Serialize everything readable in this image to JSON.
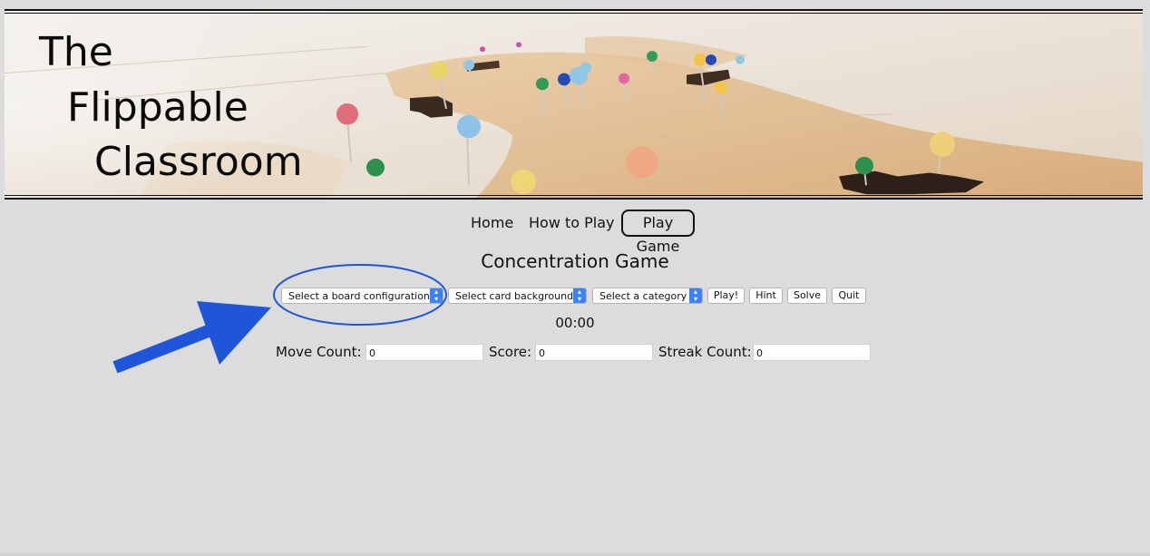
{
  "banner": {
    "title_lines": [
      "The",
      "Flippable",
      "Classroom"
    ]
  },
  "nav": {
    "items": [
      {
        "label": "Home"
      },
      {
        "label": "How to Play"
      },
      {
        "label": "Play Game",
        "active": true
      }
    ]
  },
  "game": {
    "title": "Concentration Game",
    "controls": {
      "board_select": "Select a board configuration",
      "background_select": "Select card background",
      "category_select": "Select a category",
      "play_label": "Play!",
      "hint_label": "Hint",
      "solve_label": "Solve",
      "quit_label": "Quit"
    },
    "timer": "00:00",
    "stats": {
      "move_label": "Move Count:",
      "move_value": "0",
      "score_label": "Score:",
      "score_value": "0",
      "streak_label": "Streak Count:",
      "streak_value": "0"
    }
  },
  "colors": {
    "page_background": "#dcdcdc",
    "annotation_blue": "#1f55d9",
    "select_chevron": "#3b82f6"
  }
}
